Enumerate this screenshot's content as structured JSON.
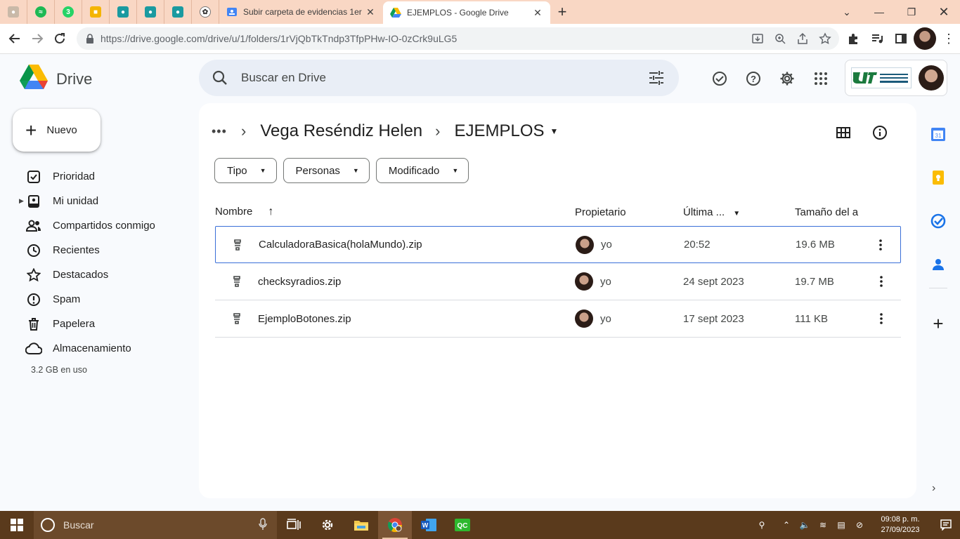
{
  "browser": {
    "tabs": [
      {
        "title": "Subir carpeta de evidencias 1er",
        "active": false
      },
      {
        "title": "EJEMPLOS - Google Drive",
        "active": true
      }
    ],
    "pinned_badge": "3",
    "url": "https://drive.google.com/drive/u/1/folders/1rVjQbTkTndp3TfpPHw-IO-0zCrk9uLG5"
  },
  "drive": {
    "logo_text": "Drive",
    "search_placeholder": "Buscar en Drive",
    "new_label": "Nuevo",
    "nav": [
      {
        "label": "Prioridad",
        "icon": "priority-icon"
      },
      {
        "label": "Mi unidad",
        "icon": "my-drive-icon"
      },
      {
        "label": "Compartidos conmigo",
        "icon": "shared-icon"
      },
      {
        "label": "Recientes",
        "icon": "clock-icon"
      },
      {
        "label": "Destacados",
        "icon": "star-icon"
      },
      {
        "label": "Spam",
        "icon": "spam-icon"
      },
      {
        "label": "Papelera",
        "icon": "trash-icon"
      },
      {
        "label": "Almacenamiento",
        "icon": "cloud-icon"
      }
    ],
    "storage_used": "3.2 GB en uso",
    "breadcrumb": {
      "parent": "Vega Reséndiz Helen",
      "current": "EJEMPLOS"
    },
    "filters": [
      "Tipo",
      "Personas",
      "Modificado"
    ],
    "columns": {
      "name": "Nombre",
      "owner": "Propietario",
      "modified": "Última ...",
      "size": "Tamaño del a"
    },
    "files": [
      {
        "name": "CalculadoraBasica(holaMundo).zip",
        "owner": "yo",
        "modified": "20:52",
        "size": "19.6 MB",
        "selected": true
      },
      {
        "name": "checksyradios.zip",
        "owner": "yo",
        "modified": "24 sept 2023",
        "size": "19.7 MB",
        "selected": false
      },
      {
        "name": "EjemploBotones.zip",
        "owner": "yo",
        "modified": "17 sept 2023",
        "size": "111 KB",
        "selected": false
      }
    ]
  },
  "taskbar": {
    "search_placeholder": "Buscar",
    "time": "09:08 p. m.",
    "date": "27/09/2023"
  },
  "colors": {
    "accent": "#0b57d0",
    "selection_border": "#3a6fd8",
    "taskbar": "#5a3a1c",
    "tabstrip": "#f9d7c4"
  }
}
